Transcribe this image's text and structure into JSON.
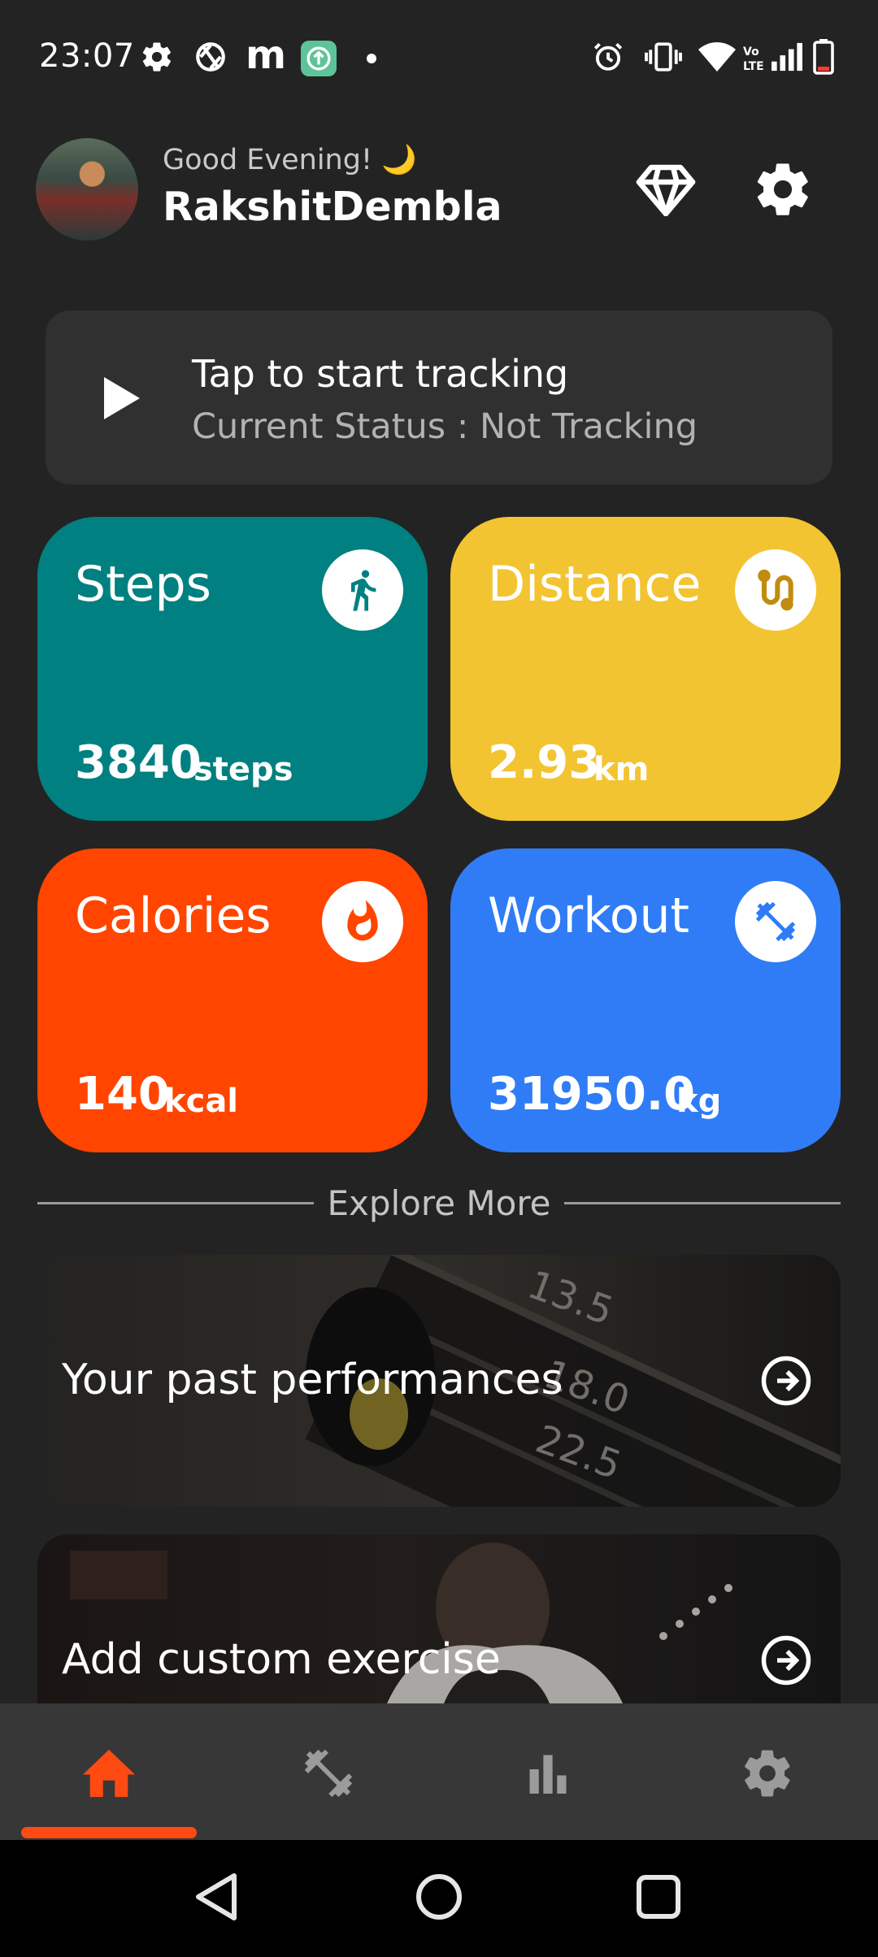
{
  "status_bar": {
    "time": "23:07",
    "left_icons": [
      "settings-gear-icon",
      "lens-icon",
      "m-icon",
      "upload-badge-icon",
      "dot-icon"
    ],
    "right_icons": [
      "alarm-icon",
      "vibrate-icon",
      "wifi-icon",
      "volte-icon",
      "signal-icon",
      "battery-icon"
    ],
    "m_letter": "m"
  },
  "header": {
    "greeting": "Good Evening! 🌙",
    "username": "RakshitDembla",
    "actions": [
      "diamond-icon",
      "settings-icon"
    ]
  },
  "tracking": {
    "title": "Tap to start tracking",
    "status": "Current Status : Not Tracking"
  },
  "stats": [
    {
      "title": "Steps",
      "value": "3840",
      "unit": "steps",
      "color": "#008080",
      "icon": "walk-icon"
    },
    {
      "title": "Distance",
      "value": "2.93",
      "unit": "km",
      "color": "#f3c431",
      "icon": "route-icon"
    },
    {
      "title": "Calories",
      "value": "140",
      "unit": "kcal",
      "color": "#ff4500",
      "icon": "fire-icon"
    },
    {
      "title": "Workout",
      "value": "31950.0",
      "unit": "kg",
      "color": "#2f7cf6",
      "icon": "dumbbell-icon"
    }
  ],
  "explore": {
    "label": "Explore More",
    "items": [
      {
        "title": "Your past performances"
      },
      {
        "title": "Add custom exercise"
      }
    ]
  },
  "bottom_nav": {
    "items": [
      "home-icon",
      "workout-icon",
      "stats-icon",
      "settings-icon"
    ],
    "active_index": 0,
    "accent": "#ff4a12"
  },
  "system_nav": [
    "back-icon",
    "home-circle-icon",
    "recents-icon"
  ]
}
